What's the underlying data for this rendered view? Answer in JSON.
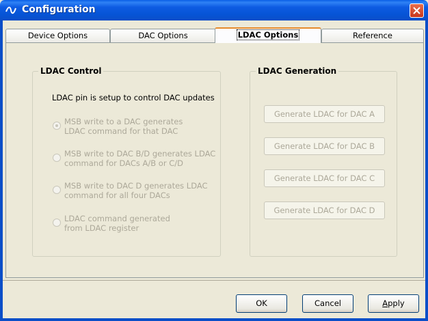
{
  "window": {
    "title": "Configuration",
    "accent": "#0a4ec8"
  },
  "tabs": [
    {
      "label": "Device Options"
    },
    {
      "label": "DAC Options"
    },
    {
      "label": "LDAC Options",
      "selected": true
    },
    {
      "label": "Reference"
    }
  ],
  "ldac_control": {
    "title": "LDAC Control",
    "intro": "LDAC pin is setup to control DAC updates",
    "options": [
      {
        "line1": "MSB write to a DAC generates",
        "line2": "LDAC command for that DAC",
        "checked": true
      },
      {
        "line1": "MSB write to DAC B/D generates LDAC",
        "line2": "command for DACs A/B or C/D",
        "checked": false
      },
      {
        "line1": "MSB write to DAC D generates LDAC",
        "line2": "command for all four DACs",
        "checked": false
      },
      {
        "line1": "LDAC command generated",
        "line2": "from LDAC register",
        "checked": false
      }
    ]
  },
  "ldac_generation": {
    "title": "LDAC Generation",
    "buttons": [
      {
        "label": "Generate LDAC for DAC A"
      },
      {
        "label": "Generate LDAC for DAC B"
      },
      {
        "label": "Generate LDAC for DAC C"
      },
      {
        "label": "Generate LDAC for DAC D"
      }
    ]
  },
  "footer": {
    "ok": "OK",
    "cancel": "Cancel",
    "apply_prefix": "A",
    "apply_rest": "pply"
  }
}
